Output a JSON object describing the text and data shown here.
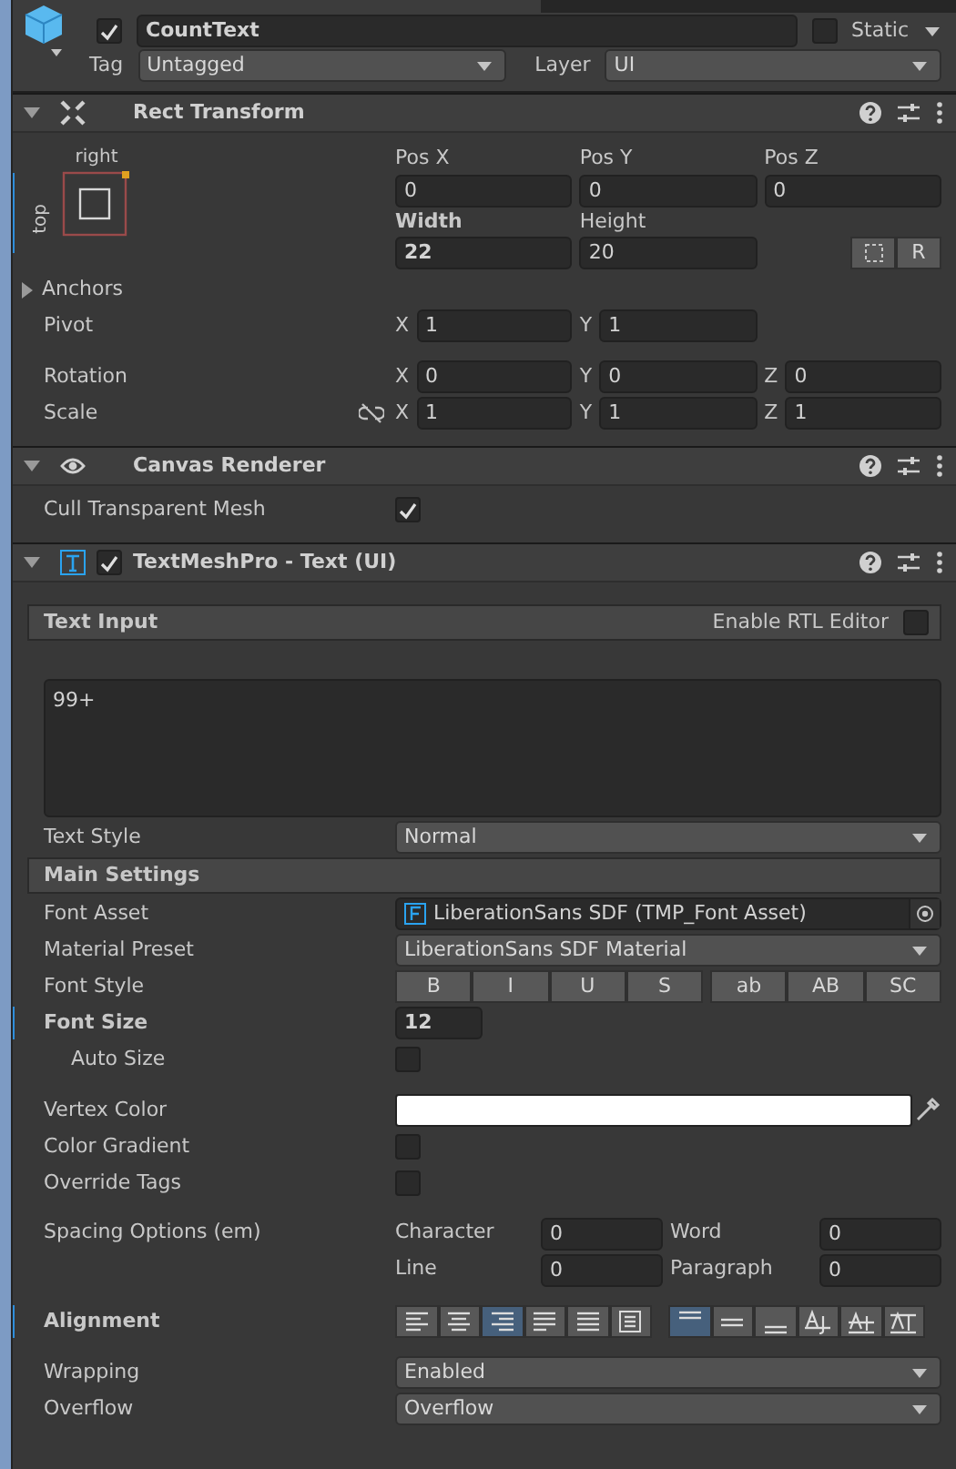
{
  "object": {
    "active": true,
    "name": "CountText",
    "static": false,
    "static_label": "Static",
    "tag_label": "Tag",
    "tag": "Untagged",
    "layer_label": "Layer",
    "layer": "UI"
  },
  "components": [
    {
      "kind": "rect_transform",
      "title": "Rect Transform",
      "expanded": true,
      "anchor": {
        "horizontal": "right",
        "vertical": "top"
      },
      "columns": [
        {
          "label": "Pos X",
          "value": "0",
          "overridden": false
        },
        {
          "label": "Pos Y",
          "value": "0",
          "overridden": false
        },
        {
          "label": "Pos Z",
          "value": "0",
          "overridden": false
        },
        {
          "label": "Width",
          "value": "22",
          "overridden": true
        },
        {
          "label": "Height",
          "value": "20",
          "overridden": false
        }
      ],
      "tool_buttons": [
        {
          "kind": "blueprint",
          "selected": false
        },
        {
          "kind": "raw",
          "label": "R",
          "selected": false
        }
      ],
      "groups": [
        [
          {
            "kind": "foldout",
            "label": "Anchors",
            "expanded": false
          },
          {
            "kind": "vector",
            "label": "Pivot",
            "fields": [
              {
                "axis": "X",
                "value": "1"
              },
              {
                "axis": "Y",
                "value": "1"
              }
            ]
          }
        ],
        [
          {
            "kind": "vector",
            "label": "Rotation",
            "fields": [
              {
                "axis": "X",
                "value": "0"
              },
              {
                "axis": "Y",
                "value": "0"
              },
              {
                "axis": "Z",
                "value": "0"
              }
            ]
          },
          {
            "kind": "vector",
            "label": "Scale",
            "linked": false,
            "fields": [
              {
                "axis": "X",
                "value": "1"
              },
              {
                "axis": "Y",
                "value": "1"
              },
              {
                "axis": "Z",
                "value": "1"
              }
            ]
          }
        ]
      ]
    },
    {
      "kind": "canvas_renderer",
      "title": "Canvas Renderer",
      "expanded": true,
      "groups": [
        [
          {
            "kind": "checkbox",
            "label": "Cull Transparent Mesh",
            "checked": true
          }
        ]
      ]
    },
    {
      "kind": "text_mesh_pro",
      "title": "TextMeshPro - Text (UI)",
      "expanded": true,
      "enabled": true,
      "sections": [
        {
          "title": "Text Input",
          "option": {
            "label": "Enable RTL Editor",
            "checked": false
          },
          "groups": [
            [
              {
                "kind": "textarea",
                "value": "99+"
              },
              {
                "kind": "dropdown",
                "label": "Text Style",
                "value": "Normal"
              }
            ]
          ]
        },
        {
          "title": "Main Settings",
          "groups": [
            [
              {
                "kind": "object",
                "label": "Font Asset",
                "value": "LiberationSans SDF (TMP_Font Asset)"
              },
              {
                "kind": "dropdown",
                "label": "Material Preset",
                "value": "LiberationSans SDF Material"
              },
              {
                "kind": "toggles",
                "label": "Font Style",
                "groups": [
                  [
                    {
                      "label": "B",
                      "selected": false
                    },
                    {
                      "label": "I",
                      "selected": false
                    },
                    {
                      "label": "U",
                      "selected": false
                    },
                    {
                      "label": "S",
                      "selected": false
                    }
                  ],
                  [
                    {
                      "label": "ab",
                      "selected": false
                    },
                    {
                      "label": "AB",
                      "selected": false
                    },
                    {
                      "label": "SC",
                      "selected": false
                    }
                  ]
                ]
              },
              {
                "kind": "number",
                "label": "Font Size",
                "value": "12",
                "overridden": true
              },
              {
                "kind": "checkbox",
                "label": "Auto Size",
                "checked": false,
                "indented": true
              }
            ],
            [
              {
                "kind": "color",
                "label": "Vertex Color",
                "color": "#ffffff"
              },
              {
                "kind": "checkbox",
                "label": "Color Gradient",
                "checked": false
              },
              {
                "kind": "checkbox",
                "label": "Override Tags",
                "checked": false
              }
            ],
            [
              {
                "kind": "spacing",
                "label": "Spacing Options (em)",
                "fields": [
                  {
                    "label": "Character",
                    "value": "0"
                  },
                  {
                    "label": "Word",
                    "value": "0"
                  },
                  {
                    "label": "Line",
                    "value": "0"
                  },
                  {
                    "label": "Paragraph",
                    "value": "0"
                  }
                ]
              }
            ],
            [
              {
                "kind": "alignment",
                "label": "Alignment",
                "overridden": true,
                "groups": [
                  [
                    {
                      "kind": "left",
                      "selected": false
                    },
                    {
                      "kind": "center",
                      "selected": false
                    },
                    {
                      "kind": "right",
                      "selected": true
                    },
                    {
                      "kind": "justified",
                      "selected": false
                    },
                    {
                      "kind": "flush",
                      "selected": false
                    },
                    {
                      "kind": "geometry",
                      "selected": false
                    }
                  ],
                  [
                    {
                      "kind": "top",
                      "selected": true
                    },
                    {
                      "kind": "middle",
                      "selected": false
                    },
                    {
                      "kind": "bottom",
                      "selected": false
                    },
                    {
                      "kind": "baseline",
                      "selected": false
                    },
                    {
                      "kind": "midline",
                      "selected": false
                    },
                    {
                      "kind": "capline",
                      "selected": false
                    }
                  ]
                ]
              }
            ],
            [
              {
                "kind": "dropdown",
                "label": "Wrapping",
                "value": "Enabled"
              },
              {
                "kind": "dropdown",
                "label": "Overflow",
                "value": "Overflow"
              }
            ]
          ]
        }
      ]
    }
  ]
}
